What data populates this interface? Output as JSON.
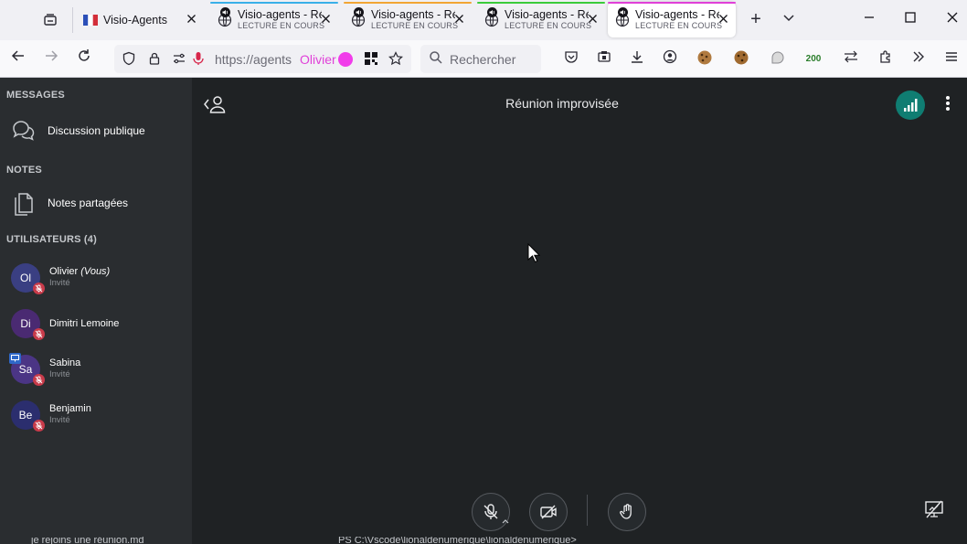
{
  "browser": {
    "tabs": [
      {
        "title": "Visio-Agents",
        "subtitle": "",
        "active": false,
        "accent": "",
        "favicon": "flag-icon"
      },
      {
        "title": "Visio-agents - Ré",
        "subtitle": "LECTURE EN COURS",
        "active": false,
        "accent": "#3ab0e8",
        "favicon": "globe-icon"
      },
      {
        "title": "Visio-agents - Ré",
        "subtitle": "LECTURE EN COURS",
        "active": false,
        "accent": "#f2a534",
        "favicon": "globe-icon"
      },
      {
        "title": "Visio-agents - Ré",
        "subtitle": "LECTURE EN COURS",
        "active": false,
        "accent": "#3bcb3b",
        "favicon": "globe-icon"
      },
      {
        "title": "Visio-agents - Ré",
        "subtitle": "LECTURE EN COURS",
        "active": true,
        "accent": "#e040d8",
        "favicon": "globe-icon"
      }
    ],
    "url": "https://agents",
    "container_label": "Olivier",
    "container_color": "#f13cea",
    "search_placeholder": "Rechercher",
    "extension_badge": "200"
  },
  "sidebar": {
    "messages_title": "MESSAGES",
    "public_chat": "Discussion publique",
    "notes_title": "NOTES",
    "shared_notes": "Notes partagées",
    "users_title": "UTILISATEURS (4)",
    "users": [
      {
        "initials": "Ol",
        "name": "Olivier",
        "you": "(Vous)",
        "role": "Invité",
        "color": "#3a3f82",
        "presenter": false
      },
      {
        "initials": "Di",
        "name": "Dimitri Lemoine",
        "you": "",
        "role": "",
        "color": "#4a2a72",
        "presenter": false
      },
      {
        "initials": "Sa",
        "name": "Sabina",
        "you": "",
        "role": "Invité",
        "color": "#4b3585",
        "presenter": true
      },
      {
        "initials": "Be",
        "name": "Benjamin",
        "you": "",
        "role": "Invité",
        "color": "#2b2e6e",
        "presenter": false
      }
    ]
  },
  "meeting": {
    "title": "Réunion improvisée",
    "connection_color": "#0f7d72"
  },
  "bottom_strip": {
    "left": "je rejoins une réunion.md",
    "right": "PS C:\\Vscode\\lionaldenumerique\\lionaldenumerique>"
  }
}
